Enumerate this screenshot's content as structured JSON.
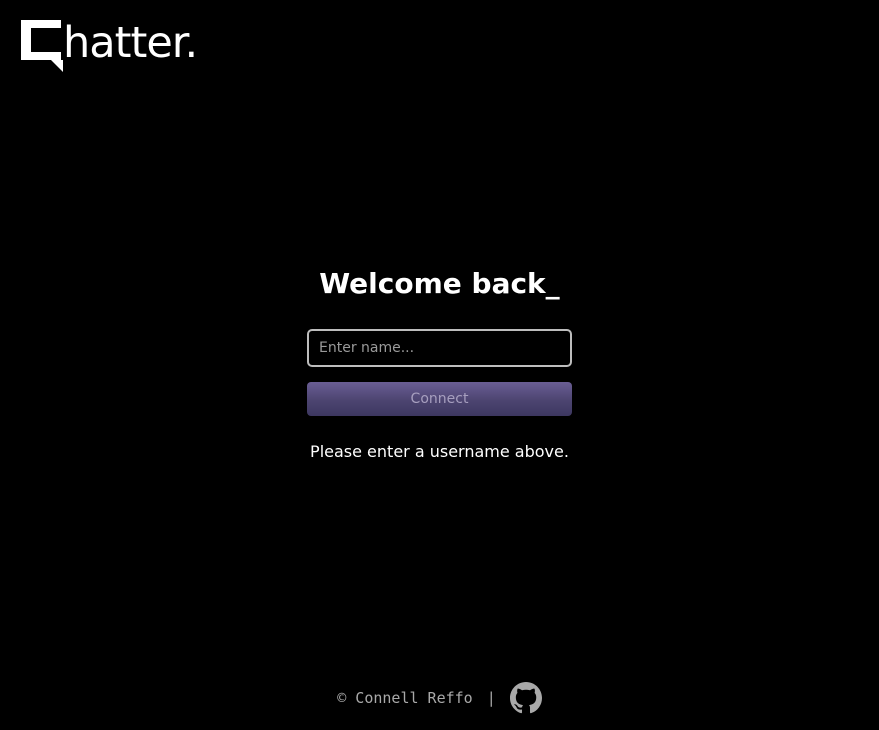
{
  "logo": {
    "text": "hatter.",
    "icon": "chat-bubble-c-icon"
  },
  "login": {
    "heading": "Welcome back_",
    "name_placeholder": "Enter name...",
    "name_value": "",
    "connect_label": "Connect",
    "status_message": "Please enter a username above."
  },
  "footer": {
    "copyright": "© Connell Reffo",
    "separator": "|",
    "github_icon": "github-icon"
  },
  "colors": {
    "background": "#000000",
    "button_top": "#6a5e94",
    "button_bottom": "#3d3760",
    "button_text": "#a79fbf",
    "footer_text": "#a9a9a9"
  }
}
